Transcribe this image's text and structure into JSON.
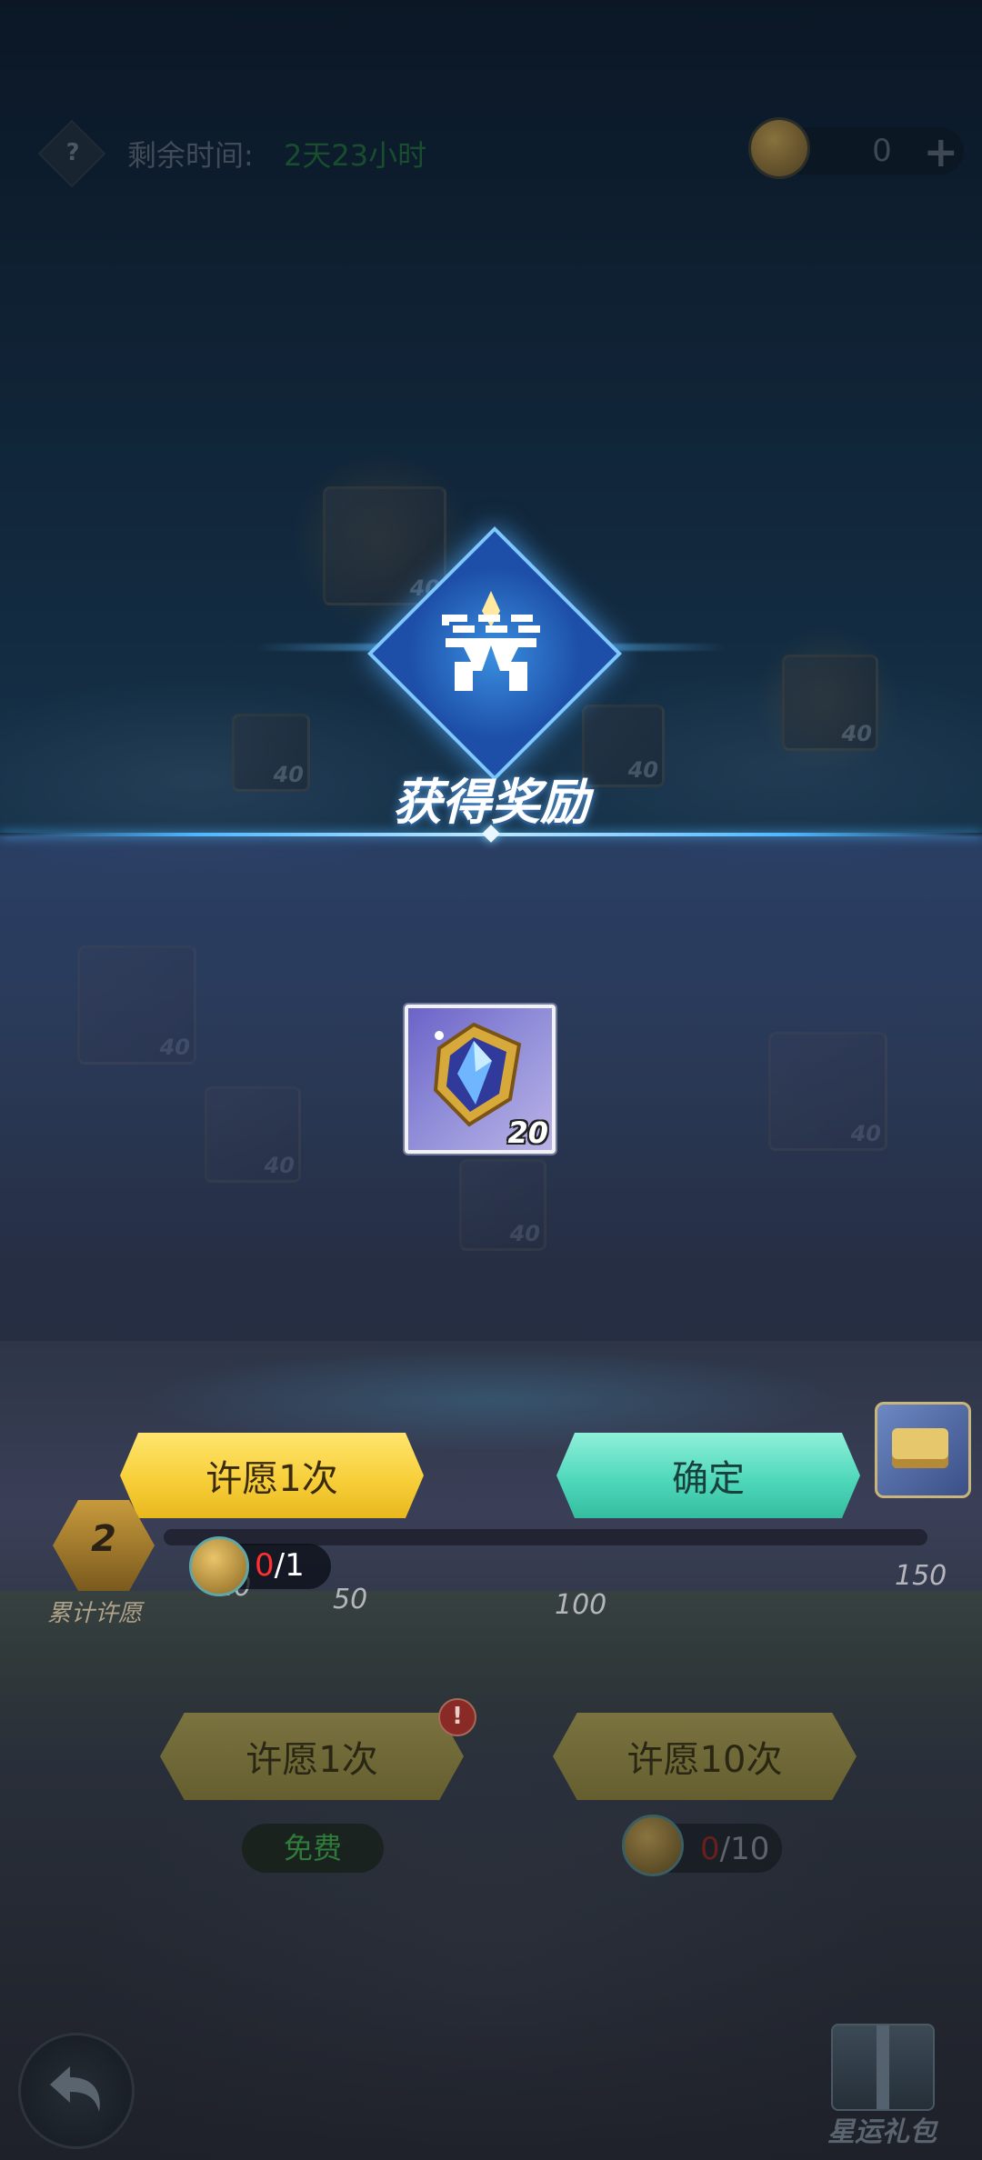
{
  "top_bar": {
    "help_symbol": "?",
    "time_label": "剩余时间:",
    "time_value": "2天23小时",
    "currency_amount": "0",
    "plus_symbol": "+"
  },
  "background_nodes": [
    "40",
    "40",
    "40",
    "40",
    "40",
    "40",
    "40",
    "40"
  ],
  "popup": {
    "title": "获得奖励",
    "reward_quantity": "20",
    "wish_once_label": "许愿1次",
    "confirm_label": "确定"
  },
  "progress": {
    "wish_count": "2",
    "wish_count_label": "累计许愿",
    "milestones": [
      "20",
      "50",
      "100",
      "150"
    ],
    "cost_current": "0",
    "cost_total": "/1"
  },
  "bottom": {
    "wish1_label": "许愿1次",
    "wish10_label": "许愿10次",
    "alert_symbol": "!",
    "free_label": "免费",
    "cost10_current": "0",
    "cost10_total": "/10",
    "gift_label": "星运礼包"
  },
  "colors": {
    "accent_blue": "#4fb7ff",
    "yellow_button": "#f7cf3a",
    "teal_button": "#4fd8bb",
    "time_green": "#1e6b33",
    "red_count": "#ff3030"
  }
}
